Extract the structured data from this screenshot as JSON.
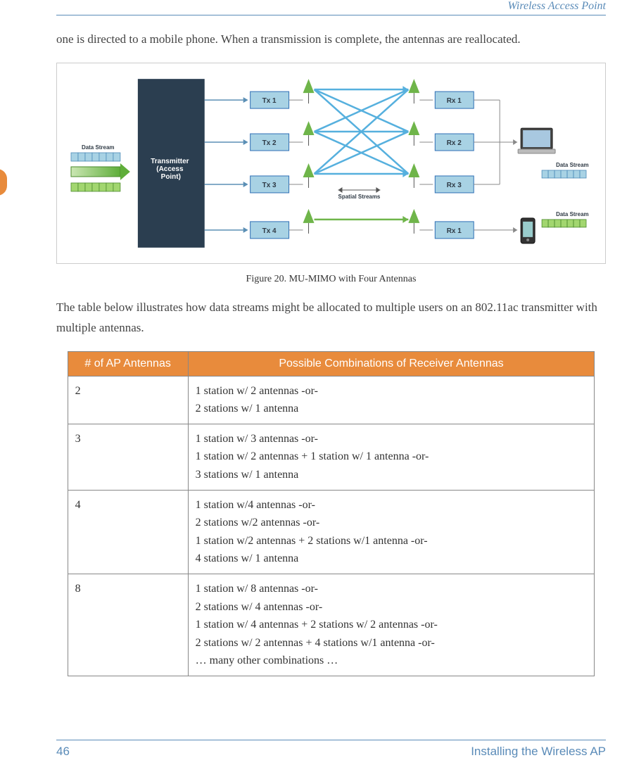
{
  "header_title": "Wireless Access Point",
  "intro_text": "one is directed to a mobile phone. When a transmission is complete, the antennas are reallocated.",
  "figure": {
    "caption": "Figure 20. MU-MIMO with Four Antennas",
    "transmitter_label": "Transmitter (Access Point)",
    "data_stream_label": "Data Stream",
    "spatial_streams_label": "Spatial Streams",
    "tx_labels": [
      "Tx 1",
      "Tx 2",
      "Tx 3",
      "Tx 4"
    ],
    "rx_labels": [
      "Rx 1",
      "Rx 2",
      "Rx 3",
      "Rx 1"
    ]
  },
  "mid_text": "The table below illustrates how data streams might be allocated to multiple users on an 802.11ac transmitter with multiple antennas.",
  "table": {
    "headers": [
      "# of AP Antennas",
      "Possible Combinations of Receiver Antennas"
    ],
    "rows": [
      {
        "n": "2",
        "c": "1 station w/ 2 antennas -or-\n2 stations w/ 1 antenna"
      },
      {
        "n": "3",
        "c": "1 station w/ 3 antennas -or-\n1 station w/ 2 antennas + 1 station w/ 1 antenna -or-\n3 stations w/ 1 antenna"
      },
      {
        "n": "4",
        "c": "1 station w/4 antennas -or-\n2 stations w/2 antennas -or-\n1 station w/2 antennas + 2 stations w/1 antenna -or-\n4 stations w/ 1 antenna"
      },
      {
        "n": "8",
        "c": "1 station w/ 8 antennas -or-\n2 stations w/ 4 antennas -or-\n1 station w/ 4 antennas + 2 stations w/ 2 antennas -or-\n2 stations w/ 2 antennas + 4 stations w/1 antenna -or-\n… many other combinations …"
      }
    ]
  },
  "footer": {
    "page": "46",
    "title": "Installing the Wireless AP"
  },
  "chart_data": {
    "type": "diagram",
    "title": "MU-MIMO with Four Antennas",
    "transmitter": "Access Point",
    "tx_antennas": 4,
    "spatial_streams_user1": [
      "Tx1→Rx1",
      "Tx1→Rx2",
      "Tx1→Rx3",
      "Tx2→Rx1",
      "Tx2→Rx2",
      "Tx2→Rx3",
      "Tx3→Rx1",
      "Tx3→Rx2",
      "Tx3→Rx3"
    ],
    "spatial_streams_user2": [
      "Tx4→Rx1"
    ],
    "receivers": [
      {
        "device": "laptop",
        "rx_antennas": 3
      },
      {
        "device": "mobile phone",
        "rx_antennas": 1
      }
    ]
  }
}
